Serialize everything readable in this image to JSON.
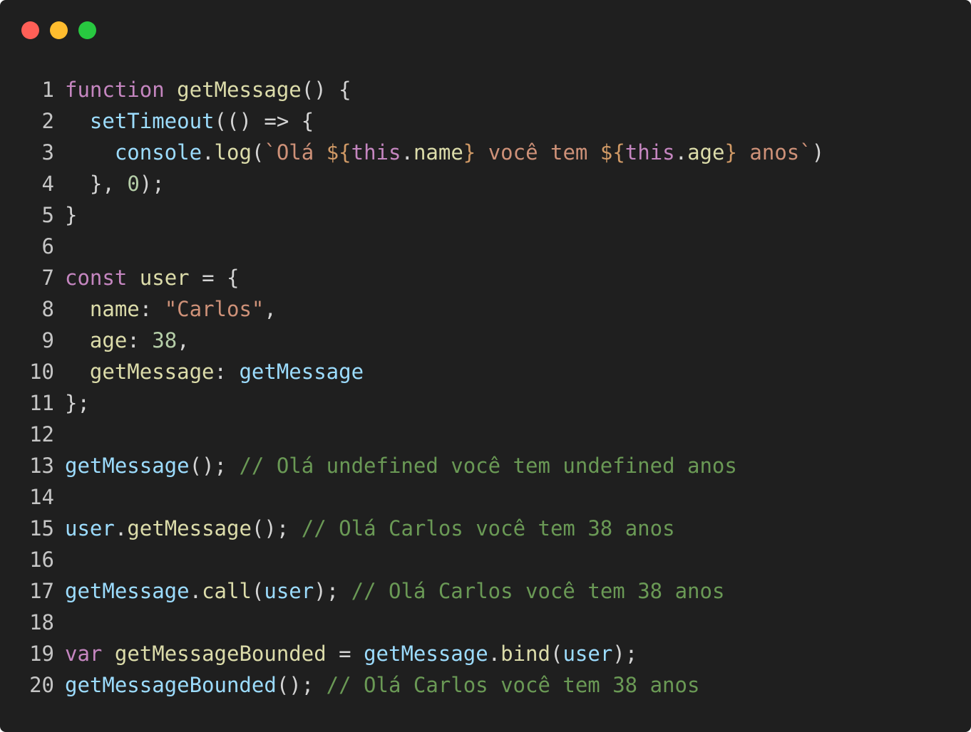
{
  "window": {
    "controls": {
      "close_color": "#ff5f57",
      "minimize_color": "#febc2e",
      "maximize_color": "#28c840"
    }
  },
  "editor": {
    "lines": [
      {
        "num": "1",
        "tokens": [
          [
            "kw",
            "function"
          ],
          [
            "pl",
            " "
          ],
          [
            "fn",
            "getMessage"
          ],
          [
            "pl",
            "() {"
          ]
        ]
      },
      {
        "num": "2",
        "tokens": [
          [
            "pl",
            "  "
          ],
          [
            "vr",
            "setTimeout"
          ],
          [
            "pl",
            "(() => {"
          ]
        ]
      },
      {
        "num": "3",
        "tokens": [
          [
            "pl",
            "    "
          ],
          [
            "vr",
            "console"
          ],
          [
            "pl",
            "."
          ],
          [
            "fn",
            "log"
          ],
          [
            "pl",
            "("
          ],
          [
            "str",
            "`Olá "
          ],
          [
            "dl",
            "${"
          ],
          [
            "th",
            "this"
          ],
          [
            "pl",
            "."
          ],
          [
            "fn",
            "name"
          ],
          [
            "dl",
            "}"
          ],
          [
            "str",
            " você tem "
          ],
          [
            "dl",
            "${"
          ],
          [
            "th",
            "this"
          ],
          [
            "pl",
            "."
          ],
          [
            "fn",
            "age"
          ],
          [
            "dl",
            "}"
          ],
          [
            "str",
            " anos`"
          ],
          [
            "pl",
            ")"
          ]
        ]
      },
      {
        "num": "4",
        "tokens": [
          [
            "pl",
            "  }, "
          ],
          [
            "num",
            "0"
          ],
          [
            "pl",
            ");"
          ]
        ]
      },
      {
        "num": "5",
        "tokens": [
          [
            "pl",
            "}"
          ]
        ]
      },
      {
        "num": "6",
        "tokens": []
      },
      {
        "num": "7",
        "tokens": [
          [
            "kw",
            "const"
          ],
          [
            "pl",
            " "
          ],
          [
            "fn",
            "user"
          ],
          [
            "pl",
            " = {"
          ]
        ]
      },
      {
        "num": "8",
        "tokens": [
          [
            "pl",
            "  "
          ],
          [
            "fn",
            "name"
          ],
          [
            "pl",
            ": "
          ],
          [
            "str",
            "\"Carlos\""
          ],
          [
            "pl",
            ","
          ]
        ]
      },
      {
        "num": "9",
        "tokens": [
          [
            "pl",
            "  "
          ],
          [
            "fn",
            "age"
          ],
          [
            "pl",
            ": "
          ],
          [
            "num",
            "38"
          ],
          [
            "pl",
            ","
          ]
        ]
      },
      {
        "num": "10",
        "tokens": [
          [
            "pl",
            "  "
          ],
          [
            "fn",
            "getMessage"
          ],
          [
            "pl",
            ": "
          ],
          [
            "vr",
            "getMessage"
          ]
        ]
      },
      {
        "num": "11",
        "tokens": [
          [
            "pl",
            "};"
          ]
        ]
      },
      {
        "num": "12",
        "tokens": []
      },
      {
        "num": "13",
        "tokens": [
          [
            "vr",
            "getMessage"
          ],
          [
            "pl",
            "(); "
          ],
          [
            "cm",
            "// Olá undefined você tem undefined anos"
          ]
        ]
      },
      {
        "num": "14",
        "tokens": []
      },
      {
        "num": "15",
        "tokens": [
          [
            "vr",
            "user"
          ],
          [
            "pl",
            "."
          ],
          [
            "fn",
            "getMessage"
          ],
          [
            "pl",
            "(); "
          ],
          [
            "cm",
            "// Olá Carlos você tem 38 anos"
          ]
        ]
      },
      {
        "num": "16",
        "tokens": []
      },
      {
        "num": "17",
        "tokens": [
          [
            "vr",
            "getMessage"
          ],
          [
            "pl",
            "."
          ],
          [
            "fn",
            "call"
          ],
          [
            "pl",
            "("
          ],
          [
            "vr",
            "user"
          ],
          [
            "pl",
            "); "
          ],
          [
            "cm",
            "// Olá Carlos você tem 38 anos"
          ]
        ]
      },
      {
        "num": "18",
        "tokens": []
      },
      {
        "num": "19",
        "tokens": [
          [
            "kw",
            "var"
          ],
          [
            "pl",
            " "
          ],
          [
            "fn",
            "getMessageBounded"
          ],
          [
            "pl",
            " = "
          ],
          [
            "vr",
            "getMessage"
          ],
          [
            "pl",
            "."
          ],
          [
            "fn",
            "bind"
          ],
          [
            "pl",
            "("
          ],
          [
            "vr",
            "user"
          ],
          [
            "pl",
            ");"
          ]
        ]
      },
      {
        "num": "20",
        "tokens": [
          [
            "vr",
            "getMessageBounded"
          ],
          [
            "pl",
            "(); "
          ],
          [
            "cm",
            "// Olá Carlos você tem 38 anos"
          ]
        ]
      }
    ]
  }
}
